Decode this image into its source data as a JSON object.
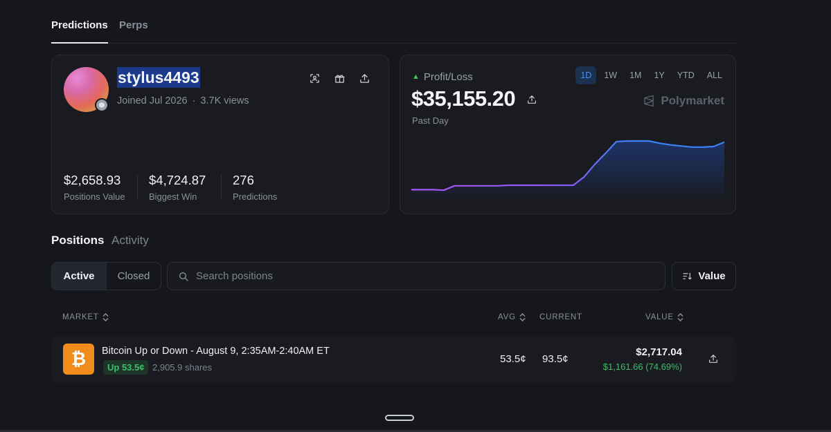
{
  "top_tabs": [
    {
      "label": "Predictions",
      "active": true
    },
    {
      "label": "Perps",
      "active": false
    }
  ],
  "profile": {
    "username": "stylus4493",
    "joined": "Joined Jul 2026",
    "views": "3.7K views",
    "actions": [
      "scan-icon",
      "gift-icon",
      "share-icon"
    ],
    "stats": [
      {
        "value": "$2,658.93",
        "label": "Positions Value"
      },
      {
        "value": "$4,724.87",
        "label": "Biggest Win"
      },
      {
        "value": "276",
        "label": "Predictions"
      }
    ]
  },
  "pnl": {
    "label": "Profit/Loss",
    "value": "$35,155.20",
    "period": "Past Day",
    "brand": "Polymarket",
    "ranges": [
      "1D",
      "1W",
      "1M",
      "1Y",
      "YTD",
      "ALL"
    ],
    "active_range": "1D",
    "colors": {
      "line_start": "#a855f7",
      "line_end": "#3b82f6",
      "up": "#3fbf6a"
    }
  },
  "chart_data": {
    "type": "line",
    "series": [
      {
        "values": [
          0.12,
          0.12,
          0.12,
          0.11,
          0.19,
          0.19,
          0.19,
          0.19,
          0.19,
          0.2,
          0.2,
          0.2,
          0.2,
          0.2,
          0.2,
          0.2,
          0.35,
          0.58,
          0.78,
          0.99,
          1.0,
          1.0,
          1.0,
          0.96,
          0.93,
          0.91,
          0.89,
          0.89,
          0.9,
          0.98
        ]
      }
    ],
    "grid": false,
    "legend": false
  },
  "positions": {
    "tabs": [
      {
        "label": "Positions",
        "active": true
      },
      {
        "label": "Activity",
        "active": false
      }
    ],
    "filter": {
      "active": "Active",
      "closed": "Closed"
    },
    "search_placeholder": "Search positions",
    "sort_label": "Value",
    "columns": {
      "market": "MARKET",
      "avg": "AVG",
      "current": "CURRENT",
      "value": "VALUE"
    },
    "rows": [
      {
        "icon": "bitcoin-icon",
        "icon_glyph": "₿",
        "market": "Bitcoin Up or Down - August 9, 2:35AM-2:40AM ET",
        "outcome": "Up 53.5¢",
        "shares": "2,905.9 shares",
        "avg": "53.5¢",
        "current": "93.5¢",
        "value": "$2,717.04",
        "pnl": "$1,161.66 (74.69%)"
      }
    ]
  }
}
